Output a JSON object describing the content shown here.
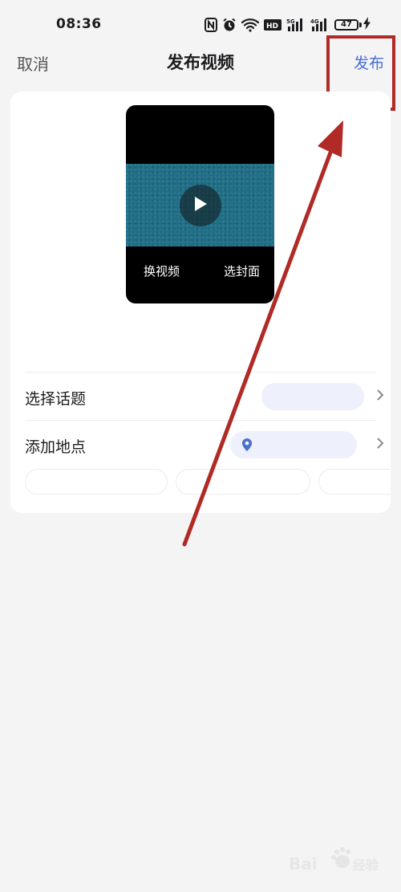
{
  "status_bar": {
    "time": "08:36",
    "battery_level": "47",
    "icons": [
      "nfc-icon",
      "alarm-icon",
      "wifi-icon",
      "hd-icon",
      "signal-5g-icon",
      "signal-4g-icon",
      "battery-icon",
      "charging-icon"
    ]
  },
  "nav": {
    "cancel_label": "取消",
    "title": "发布视频",
    "publish_label": "发布"
  },
  "video": {
    "replace_label": "换视频",
    "cover_label": "选封面"
  },
  "rows": {
    "topic_label": "选择话题",
    "location_label": "添加地点"
  },
  "colors": {
    "accent": "#4a6fcf",
    "annotation": "#b02a26",
    "pill_bg": "#eef0fb",
    "video_frame": "#1f6e86"
  }
}
